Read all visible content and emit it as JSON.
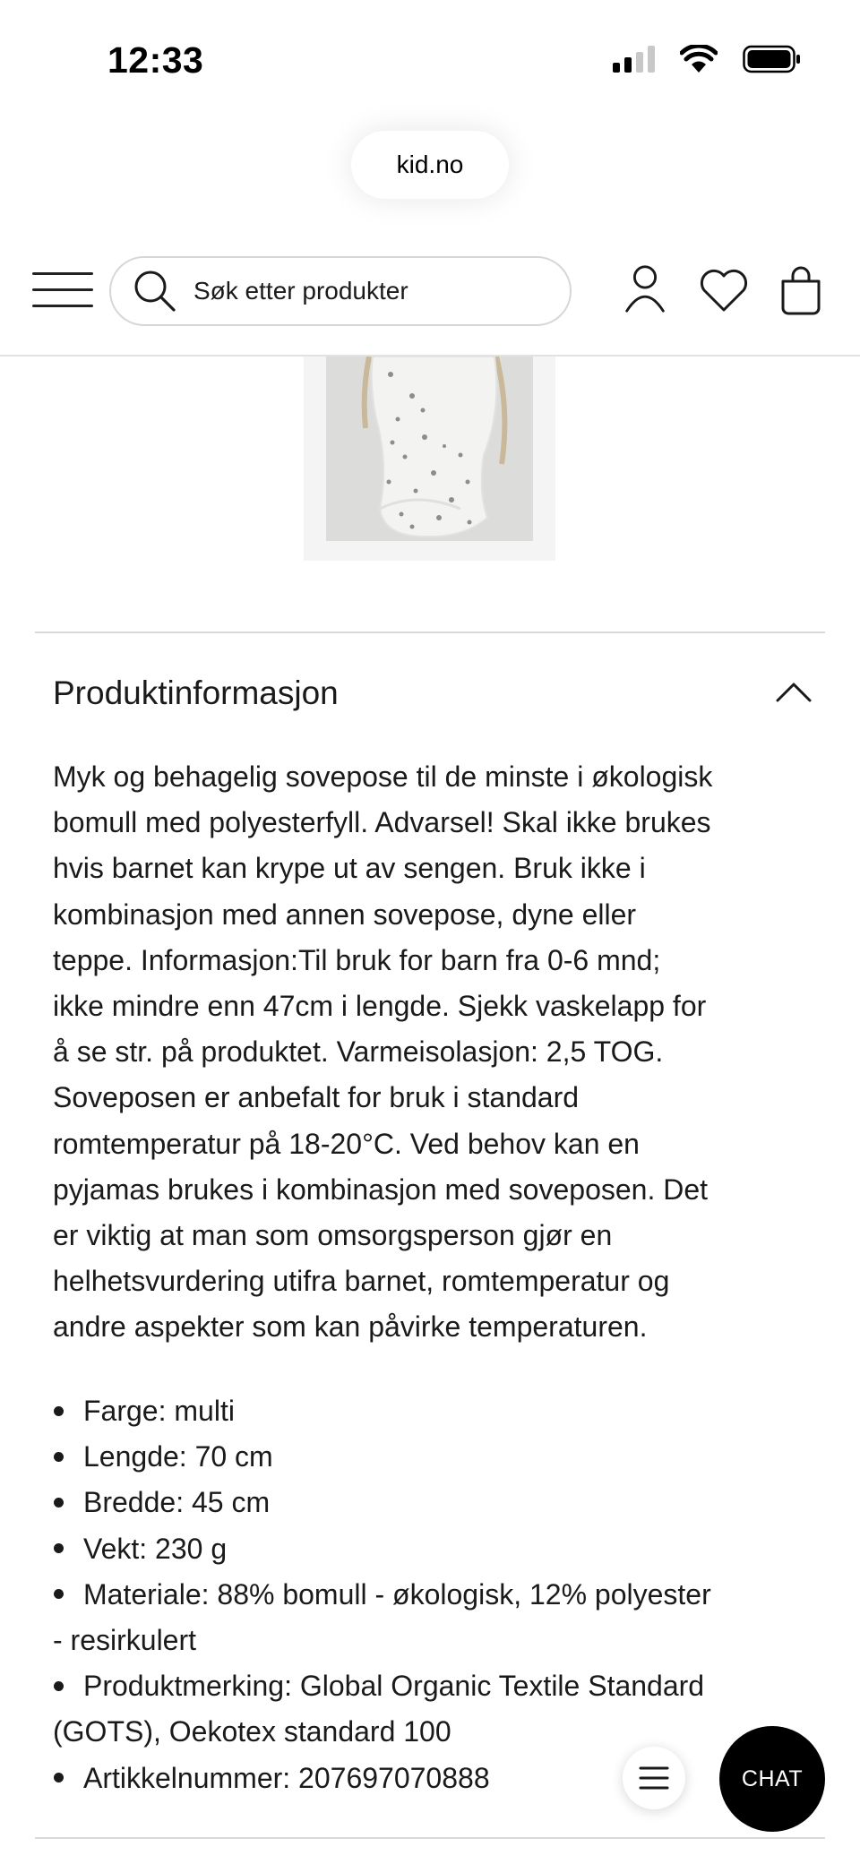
{
  "status_bar": {
    "time": "12:33",
    "icons": [
      "cellular-signal-icon",
      "wifi-icon",
      "battery-icon"
    ]
  },
  "browser": {
    "url": "kid.no"
  },
  "header": {
    "search_placeholder": "Søk etter produkter",
    "icons": [
      "menu-icon",
      "search-icon",
      "account-icon",
      "heart-icon",
      "shopping-bag-icon"
    ]
  },
  "product_info": {
    "title": "Produktinformasjon",
    "expanded": true,
    "description_lines": [
      "Myk og behagelig sovepose til de minste i økologisk",
      "bomull med polyesterfyll. Advarsel! Skal ikke brukes",
      "hvis barnet kan krype ut av sengen. Bruk ikke i",
      "kombinasjon med annen sovepose, dyne eller",
      "teppe. Informasjon:Til bruk for barn fra 0-6 mnd;",
      "ikke mindre enn 47cm i lengde. Sjekk vaskelapp for",
      "å se str. på produktet. Varmeisolasjon: 2,5 TOG.",
      "Soveposen er anbefalt for bruk i standard",
      "romtemperatur på 18-20°C. Ved behov kan en",
      "pyjamas brukes i kombinasjon med soveposen. Det",
      "er viktig at man som omsorgsperson gjør en",
      "helhetsvurdering utifra barnet, romtemperatur og",
      "andre aspekter som kan påvirke temperaturen."
    ],
    "specs": [
      {
        "first": "Farge: multi",
        "cont": ""
      },
      {
        "first": "Lengde: 70 cm",
        "cont": ""
      },
      {
        "first": "Bredde: 45 cm",
        "cont": ""
      },
      {
        "first": "Vekt: 230 g",
        "cont": ""
      },
      {
        "first": "Materiale: 88% bomull - økologisk, 12% polyester",
        "cont": "- resirkulert"
      },
      {
        "first": "Produktmerking: Global Organic Textile Standard",
        "cont": "(GOTS), Oekotex standard 100"
      },
      {
        "first": "Artikkelnummer: 207697070888",
        "cont": ""
      }
    ]
  },
  "floating": {
    "chat_label": "CHAT"
  },
  "colors": {
    "text": "#1a1a1a",
    "divider": "#d9d9d9",
    "chat_bg": "#000000"
  }
}
